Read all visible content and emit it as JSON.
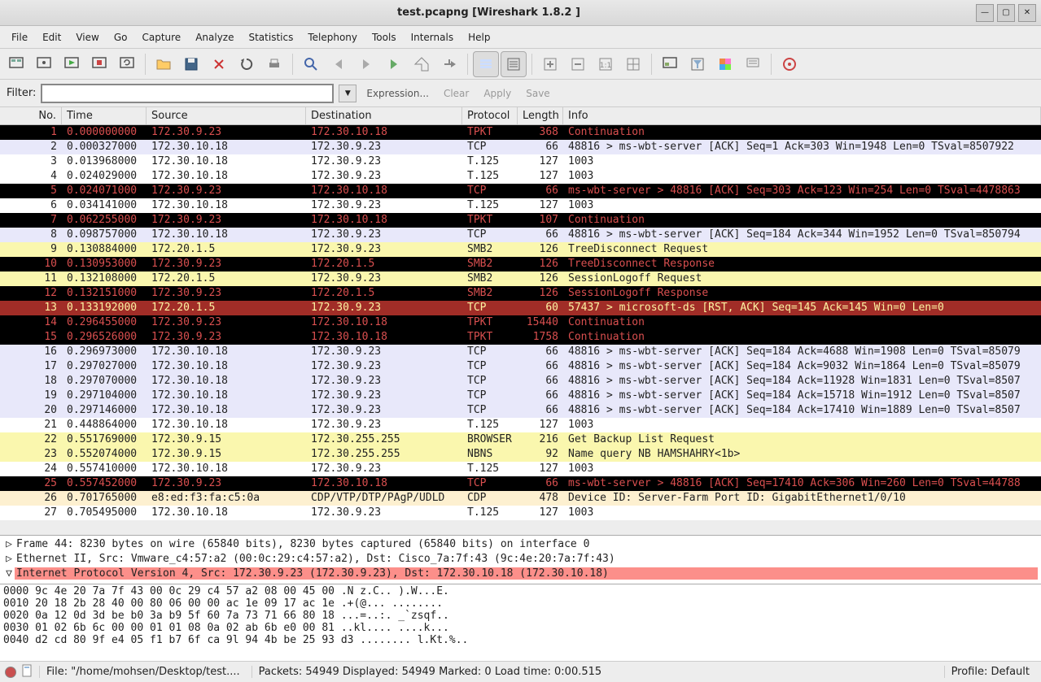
{
  "window_title": "test.pcapng   [Wireshark 1.8.2 ]",
  "menu": [
    "File",
    "Edit",
    "View",
    "Go",
    "Capture",
    "Analyze",
    "Statistics",
    "Telephony",
    "Tools",
    "Internals",
    "Help"
  ],
  "filter": {
    "label": "Filter:",
    "value": "",
    "expression": "Expression...",
    "clear": "Clear",
    "apply": "Apply",
    "save": "Save"
  },
  "columns": {
    "no": "No.",
    "time": "Time",
    "src": "Source",
    "dst": "Destination",
    "proto": "Protocol",
    "len": "Length",
    "info": "Info"
  },
  "packets": [
    {
      "no": 1,
      "time": "0.000000000",
      "src": "172.30.9.23",
      "dst": "172.30.10.18",
      "proto": "TPKT",
      "len": 368,
      "info": "Continuation",
      "style": "black-red"
    },
    {
      "no": 2,
      "time": "0.000327000",
      "src": "172.30.10.18",
      "dst": "172.30.9.23",
      "proto": "TCP",
      "len": 66,
      "info": "48816 > ms-wbt-server [ACK] Seq=1 Ack=303 Win=1948 Len=0 TSval=8507922",
      "style": "lav"
    },
    {
      "no": 3,
      "time": "0.013968000",
      "src": "172.30.10.18",
      "dst": "172.30.9.23",
      "proto": "T.125",
      "len": 127,
      "info": "1003",
      "style": ""
    },
    {
      "no": 4,
      "time": "0.024029000",
      "src": "172.30.10.18",
      "dst": "172.30.9.23",
      "proto": "T.125",
      "len": 127,
      "info": "1003",
      "style": ""
    },
    {
      "no": 5,
      "time": "0.024071000",
      "src": "172.30.9.23",
      "dst": "172.30.10.18",
      "proto": "TCP",
      "len": 66,
      "info": "ms-wbt-server > 48816 [ACK] Seq=303 Ack=123 Win=254 Len=0 TSval=4478863",
      "style": "black-red"
    },
    {
      "no": 6,
      "time": "0.034141000",
      "src": "172.30.10.18",
      "dst": "172.30.9.23",
      "proto": "T.125",
      "len": 127,
      "info": "1003",
      "style": ""
    },
    {
      "no": 7,
      "time": "0.062255000",
      "src": "172.30.9.23",
      "dst": "172.30.10.18",
      "proto": "TPKT",
      "len": 107,
      "info": "Continuation",
      "style": "black-red"
    },
    {
      "no": 8,
      "time": "0.098757000",
      "src": "172.30.10.18",
      "dst": "172.30.9.23",
      "proto": "TCP",
      "len": 66,
      "info": "48816 > ms-wbt-server [ACK] Seq=184 Ack=344 Win=1952 Len=0 TSval=850794",
      "style": "lav"
    },
    {
      "no": 9,
      "time": "0.130884000",
      "src": "172.20.1.5",
      "dst": "172.30.9.23",
      "proto": "SMB2",
      "len": 126,
      "info": "TreeDisconnect Request",
      "style": "yellow"
    },
    {
      "no": 10,
      "time": "0.130953000",
      "src": "172.30.9.23",
      "dst": "172.20.1.5",
      "proto": "SMB2",
      "len": 126,
      "info": "TreeDisconnect Response",
      "style": "black-red"
    },
    {
      "no": 11,
      "time": "0.132108000",
      "src": "172.20.1.5",
      "dst": "172.30.9.23",
      "proto": "SMB2",
      "len": 126,
      "info": "SessionLogoff Request",
      "style": "yellow"
    },
    {
      "no": 12,
      "time": "0.132151000",
      "src": "172.30.9.23",
      "dst": "172.20.1.5",
      "proto": "SMB2",
      "len": 126,
      "info": "SessionLogoff Response",
      "style": "black-red"
    },
    {
      "no": 13,
      "time": "0.133192000",
      "src": "172.20.1.5",
      "dst": "172.30.9.23",
      "proto": "TCP",
      "len": 60,
      "info": "57437 > microsoft-ds [RST, ACK] Seq=145 Ack=145 Win=0 Len=0",
      "style": "darkred"
    },
    {
      "no": 14,
      "time": "0.296455000",
      "src": "172.30.9.23",
      "dst": "172.30.10.18",
      "proto": "TPKT",
      "len": 15440,
      "info": "Continuation",
      "style": "black-red"
    },
    {
      "no": 15,
      "time": "0.296526000",
      "src": "172.30.9.23",
      "dst": "172.30.10.18",
      "proto": "TPKT",
      "len": 1758,
      "info": "Continuation",
      "style": "black-red"
    },
    {
      "no": 16,
      "time": "0.296973000",
      "src": "172.30.10.18",
      "dst": "172.30.9.23",
      "proto": "TCP",
      "len": 66,
      "info": "48816 > ms-wbt-server [ACK] Seq=184 Ack=4688 Win=1908 Len=0 TSval=85079",
      "style": "lav"
    },
    {
      "no": 17,
      "time": "0.297027000",
      "src": "172.30.10.18",
      "dst": "172.30.9.23",
      "proto": "TCP",
      "len": 66,
      "info": "48816 > ms-wbt-server [ACK] Seq=184 Ack=9032 Win=1864 Len=0 TSval=85079",
      "style": "lav"
    },
    {
      "no": 18,
      "time": "0.297070000",
      "src": "172.30.10.18",
      "dst": "172.30.9.23",
      "proto": "TCP",
      "len": 66,
      "info": "48816 > ms-wbt-server [ACK] Seq=184 Ack=11928 Win=1831 Len=0 TSval=8507",
      "style": "lav"
    },
    {
      "no": 19,
      "time": "0.297104000",
      "src": "172.30.10.18",
      "dst": "172.30.9.23",
      "proto": "TCP",
      "len": 66,
      "info": "48816 > ms-wbt-server [ACK] Seq=184 Ack=15718 Win=1912 Len=0 TSval=8507",
      "style": "lav"
    },
    {
      "no": 20,
      "time": "0.297146000",
      "src": "172.30.10.18",
      "dst": "172.30.9.23",
      "proto": "TCP",
      "len": 66,
      "info": "48816 > ms-wbt-server [ACK] Seq=184 Ack=17410 Win=1889 Len=0 TSval=8507",
      "style": "lav"
    },
    {
      "no": 21,
      "time": "0.448864000",
      "src": "172.30.10.18",
      "dst": "172.30.9.23",
      "proto": "T.125",
      "len": 127,
      "info": "1003",
      "style": ""
    },
    {
      "no": 22,
      "time": "0.551769000",
      "src": "172.30.9.15",
      "dst": "172.30.255.255",
      "proto": "BROWSER",
      "len": 216,
      "info": "Get Backup List Request",
      "style": "yellow"
    },
    {
      "no": 23,
      "time": "0.552074000",
      "src": "172.30.9.15",
      "dst": "172.30.255.255",
      "proto": "NBNS",
      "len": 92,
      "info": "Name query NB HAMSHAHRY<1b>",
      "style": "yellow"
    },
    {
      "no": 24,
      "time": "0.557410000",
      "src": "172.30.10.18",
      "dst": "172.30.9.23",
      "proto": "T.125",
      "len": 127,
      "info": "1003",
      "style": ""
    },
    {
      "no": 25,
      "time": "0.557452000",
      "src": "172.30.9.23",
      "dst": "172.30.10.18",
      "proto": "TCP",
      "len": 66,
      "info": "ms-wbt-server > 48816 [ACK] Seq=17410 Ack=306 Win=260 Len=0 TSval=44788",
      "style": "black-red"
    },
    {
      "no": 26,
      "time": "0.701765000",
      "src": "e8:ed:f3:fa:c5:0a",
      "dst": "CDP/VTP/DTP/PAgP/UDLD",
      "proto": "CDP",
      "len": 478,
      "info": "Device ID: Server-Farm  Port ID: GigabitEthernet1/0/10",
      "style": "cream"
    },
    {
      "no": 27,
      "time": "0.705495000",
      "src": "172.30.10.18",
      "dst": "172.30.9.23",
      "proto": "T.125",
      "len": 127,
      "info": "1003",
      "style": ""
    }
  ],
  "tree": [
    {
      "expand": "▷",
      "text": "Frame 44: 8230 bytes on wire (65840 bits), 8230 bytes captured (65840 bits) on interface 0",
      "hl": false
    },
    {
      "expand": "▷",
      "text": "Ethernet II, Src: Vmware_c4:57:a2 (00:0c:29:c4:57:a2), Dst: Cisco_7a:7f:43 (9c:4e:20:7a:7f:43)",
      "hl": false
    },
    {
      "expand": "▽",
      "text": "Internet Protocol Version 4, Src: 172.30.9.23 (172.30.9.23), Dst: 172.30.10.18 (172.30.10.18)",
      "hl": true
    }
  ],
  "hex": [
    "0000  9c 4e 20 7a 7f 43 00 0c  29 c4 57 a2 08 00 45 00   .N z.C.. ).W...E.",
    "0010  20 18 2b 28 40 00 80 06  00 00 ac 1e 09 17 ac 1e    .+(@... ........",
    "0020  0a 12 0d 3d be b0 3a b9  5f 60 7a 73 71 66 80 18   ...=..:. _`zsqf..",
    "0030  01 02 6b 6c 00 00 01 01  08 0a 02 ab 6b e0 00 81   ..kl.... ....k...",
    "0040  d2 cd 80 9f e4 05 f1 b7  6f ca 9l 94 4b be 25 93 d3   ........ l.Kt.%.."
  ],
  "status": {
    "file": "File: \"/home/mohsen/Desktop/test....",
    "stats": "Packets: 54949 Displayed: 54949 Marked: 0 Load time: 0:00.515",
    "profile": "Profile: Default"
  }
}
